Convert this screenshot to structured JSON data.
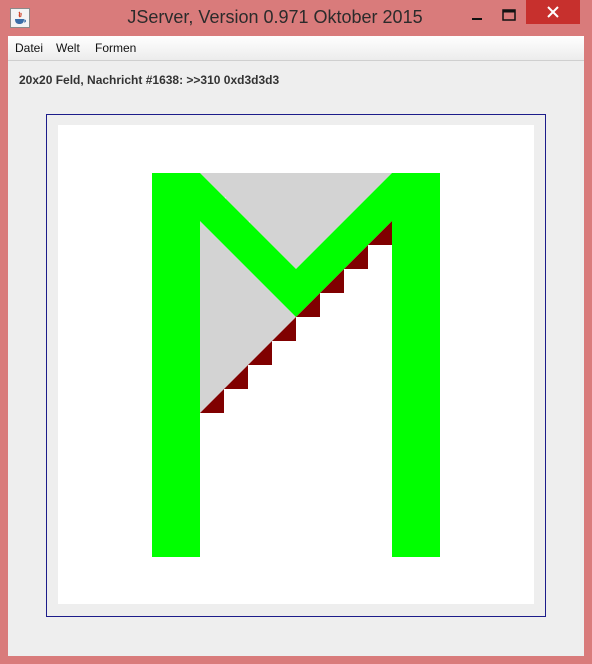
{
  "window": {
    "title": "JServer, Version 0.971 Oktober 2015",
    "icon": "java-icon",
    "controls": [
      "minimize-icon",
      "maximize-icon",
      "close-icon"
    ]
  },
  "menubar": {
    "items": [
      {
        "label": "Datei"
      },
      {
        "label": "Welt"
      },
      {
        "label": "Formen"
      }
    ]
  },
  "status": {
    "text": "20x20 Feld, Nachricht #1638: >>310 0xd3d3d3"
  },
  "board": {
    "grid_size": "20x20",
    "colors": {
      "letter": "#00ff00",
      "fill": "#d3d3d3",
      "stair": "#800000",
      "background": "#ffffff",
      "frame": "#1c1c8a"
    }
  }
}
